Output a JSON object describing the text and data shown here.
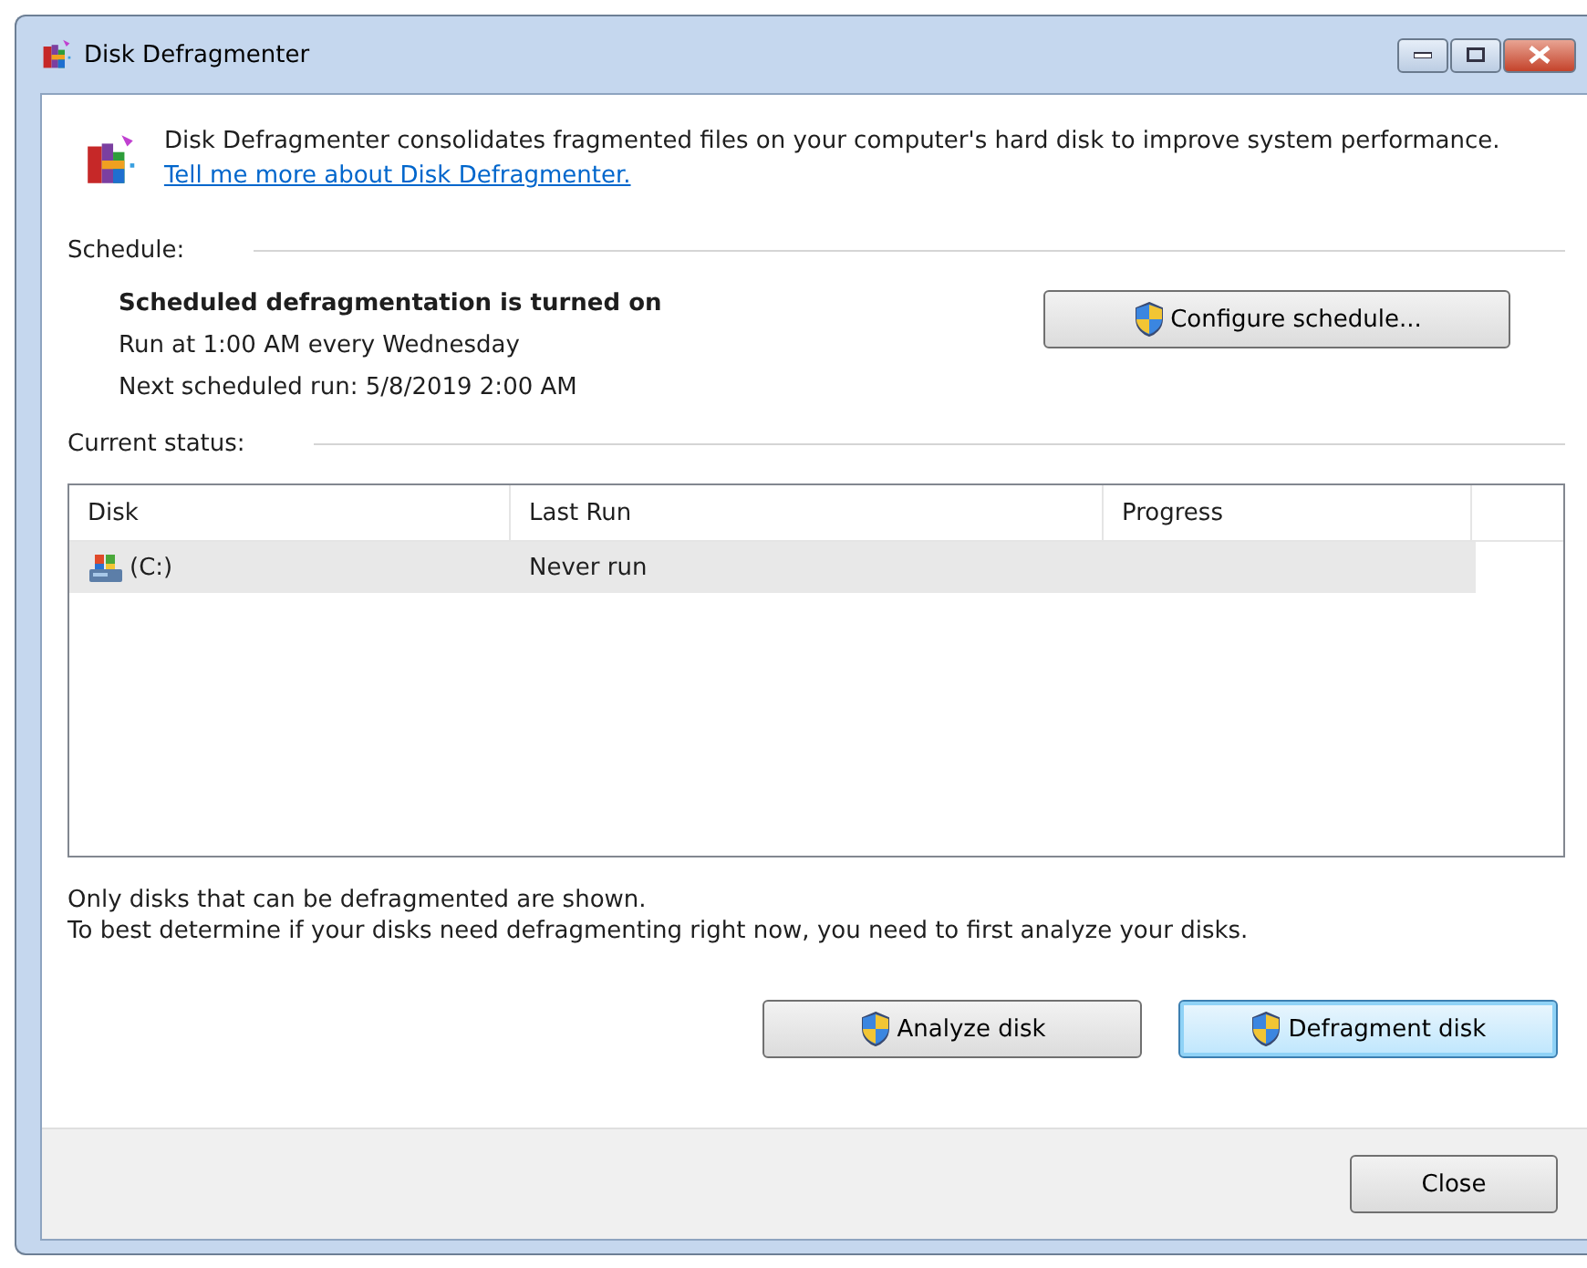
{
  "window": {
    "title": "Disk Defragmenter",
    "controls": [
      {
        "kind": "minimize"
      },
      {
        "kind": "maximize"
      },
      {
        "kind": "close"
      }
    ]
  },
  "intro": {
    "text": "Disk Defragmenter consolidates fragmented files on your computer's hard disk to improve system performance.",
    "link": "Tell me more about Disk Defragmenter."
  },
  "schedule": {
    "heading": "Schedule:",
    "status": "Scheduled defragmentation is turned on",
    "run_at": "Run at 1:00 AM every Wednesday",
    "next_run": "Next scheduled run: 5/8/2019 2:00 AM",
    "button": "Configure schedule..."
  },
  "current_status": {
    "heading": "Current status:",
    "columns": [
      "Disk",
      "Last Run",
      "Progress"
    ],
    "rows": [
      {
        "disk": "(C:)",
        "last_run": "Never run",
        "progress": "",
        "selected": true
      }
    ]
  },
  "notes": [
    "Only disks that can be defragmented are shown.",
    "To best determine if your disks need defragmenting right now, you need to first analyze your disks."
  ],
  "actions": [
    {
      "label": "Analyze disk",
      "focused": false
    },
    {
      "label": "Defragment disk",
      "focused": true
    }
  ],
  "footer_button": "Close"
}
